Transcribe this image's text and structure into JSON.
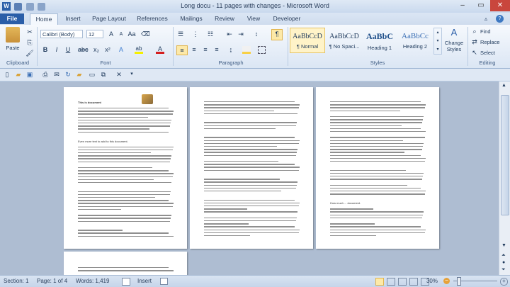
{
  "window": {
    "title": "Long docu - 11 pages with changes  -  Microsoft Word",
    "minimize": "–",
    "restore": "▭",
    "close": "✕"
  },
  "tabs": [
    "File",
    "Home",
    "Insert",
    "Page Layout",
    "References",
    "Mailings",
    "Review",
    "View",
    "Developer"
  ],
  "ribbon": {
    "clipboard": {
      "paste": "Paste",
      "label": "Clipboard"
    },
    "font": {
      "name": "Calibri (Body)",
      "size": "12",
      "label": "Font",
      "bold": "B",
      "italic": "I",
      "underline": "U"
    },
    "paragraph": {
      "label": "Paragraph",
      "pilcrow": "¶"
    },
    "styles": {
      "label": "Styles",
      "items": [
        {
          "sample": "AaBbCcD",
          "name": "¶ Normal"
        },
        {
          "sample": "AaBbCcD",
          "name": "¶ No Spaci..."
        },
        {
          "sample": "AaBbC",
          "name": "Heading 1"
        },
        {
          "sample": "AaBbCc",
          "name": "Heading 2"
        }
      ],
      "change": "Change Styles"
    },
    "editing": {
      "label": "Editing",
      "find": "Find",
      "replace": "Replace",
      "select": "Select"
    }
  },
  "document": {
    "heading1": "This is document",
    "heading2": "Even more text to add to this document.",
    "heading3": "How much ... document."
  },
  "status": {
    "section": "Section: 1",
    "page": "Page: 1 of 4",
    "words": "Words: 1,419",
    "mode": "Insert",
    "zoom": "30%"
  }
}
